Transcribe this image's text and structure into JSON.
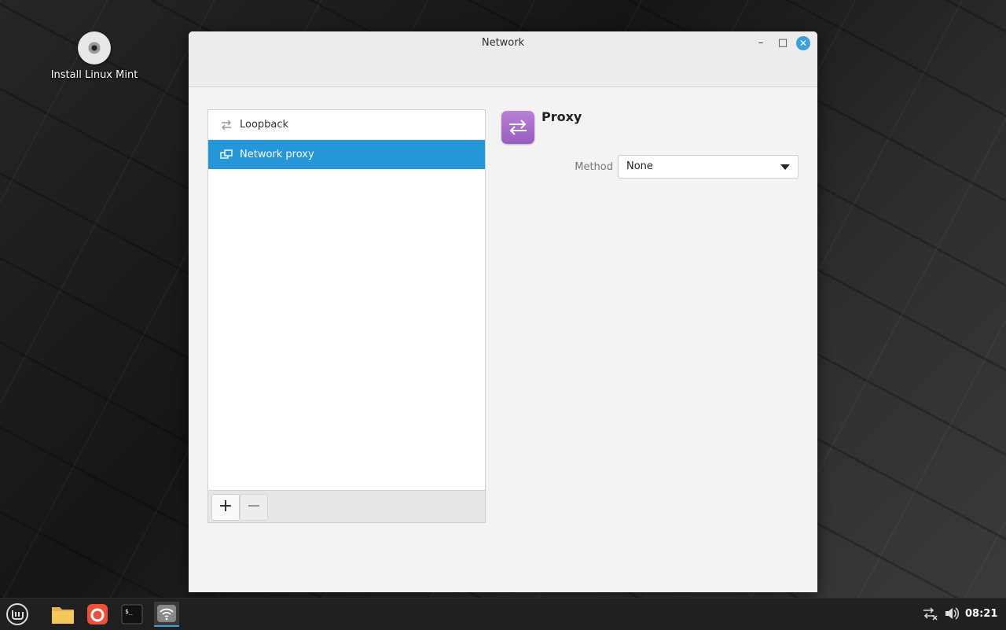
{
  "desktop": {
    "icon_label": "Install Linux Mint"
  },
  "window": {
    "title": "Network",
    "controls": {
      "minimize": "–",
      "maximize": "□",
      "close": "✕"
    }
  },
  "connections": {
    "items": [
      {
        "label": "Loopback",
        "icon": "loopback-arrows-icon",
        "selected": false
      },
      {
        "label": "Network proxy",
        "icon": "network-proxy-icon",
        "selected": true
      }
    ],
    "add_label": "+",
    "remove_label": "−"
  },
  "proxy": {
    "title": "Proxy",
    "method_label": "Method",
    "method_value": "None"
  },
  "taskbar": {
    "clock": "08:21",
    "apps": [
      "mint-menu-icon",
      "files-folder-icon",
      "firefox-icon",
      "terminal-icon",
      "network-settings-icon"
    ]
  },
  "colors": {
    "accent": "#2596d8",
    "proxy_icon": "#a96bcc"
  }
}
